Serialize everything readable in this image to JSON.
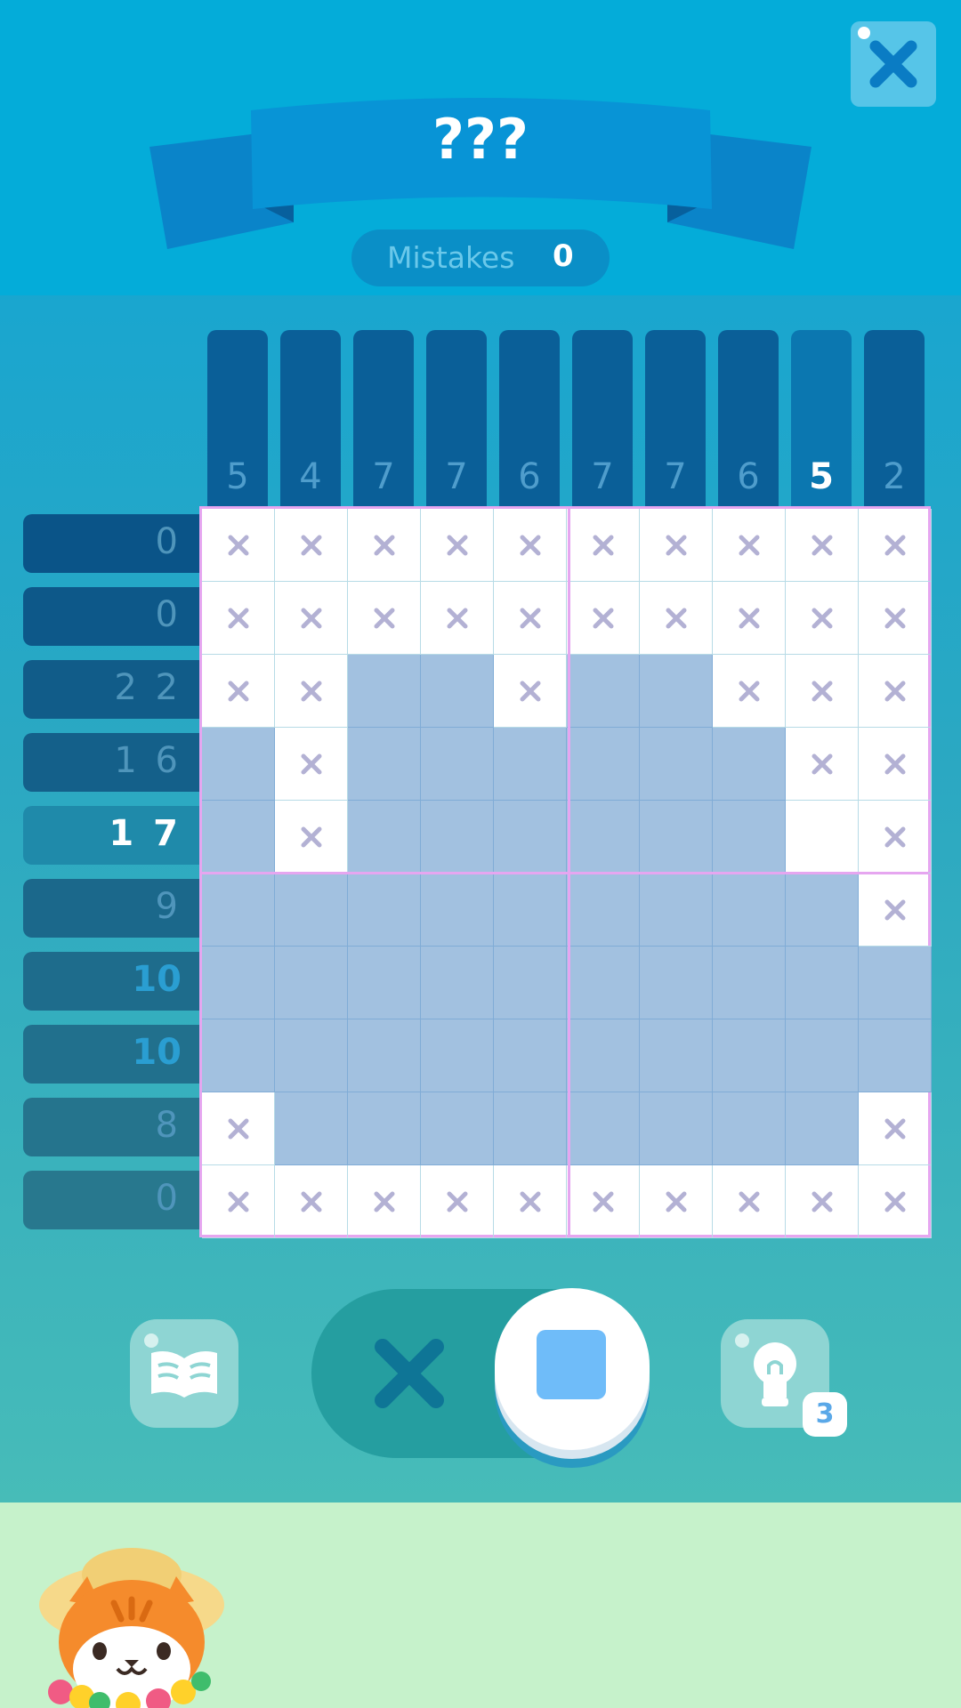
{
  "header": {
    "title": "???",
    "mistakes_label": "Mistakes",
    "mistakes_count": "0",
    "close_icon": "close-x-icon"
  },
  "puzzle": {
    "col_clues": [
      "5",
      "4",
      "7",
      "7",
      "6",
      "7",
      "7",
      "6",
      "5",
      "2"
    ],
    "active_col": 8,
    "row_clues": [
      "0",
      "0",
      "2 2",
      "1 6",
      "1 7",
      "9",
      "10",
      "10",
      "8",
      "0"
    ],
    "active_row": 4,
    "completed_rows": [
      6,
      7
    ],
    "grid": [
      "xxxxxxxxxx",
      "xxxxxxxxxx",
      "xx##x##xxx",
      "#x######xx",
      "#x######.x",
      "#########x",
      "##########",
      "##########",
      "x########x",
      "xxxxxxxxxx"
    ]
  },
  "toolbar": {
    "guide_icon": "book-icon",
    "mark_mode_icon": "x-mark-icon",
    "fill_mode_icon": "fill-square-icon",
    "selected_mode": "fill",
    "hint_icon": "lightbulb-icon",
    "hint_count": "3"
  },
  "mascot": {
    "icon": "cat-with-straw-hat"
  },
  "colors": {
    "top_bg": "#04acd9",
    "filled_cell": "#a2c1e0",
    "grid_divider": "#e6a6f0",
    "x_mark": "#b3b1d4",
    "footer_bg": "#c6f2cb"
  }
}
